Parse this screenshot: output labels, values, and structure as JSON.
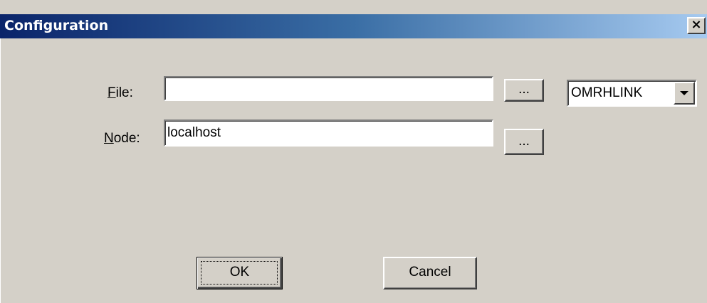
{
  "window": {
    "title": "Configuration",
    "close_glyph": "×"
  },
  "form": {
    "file_label_mnemonic": "F",
    "file_label_rest": "ile:",
    "file_value": "",
    "node_label_mnemonic": "N",
    "node_label_rest": "ode:",
    "node_value": "localhost",
    "browse_label": "..."
  },
  "dropdown": {
    "selected": "OMRHLINK"
  },
  "buttons": {
    "ok_label": "OK",
    "cancel_label": "Cancel"
  },
  "colors": {
    "title_start": "#0a246a",
    "title_end": "#a6caf0",
    "face": "#d4d0c8"
  },
  "icons": {
    "close": "close-icon",
    "dropdown": "chevron-down-icon"
  }
}
